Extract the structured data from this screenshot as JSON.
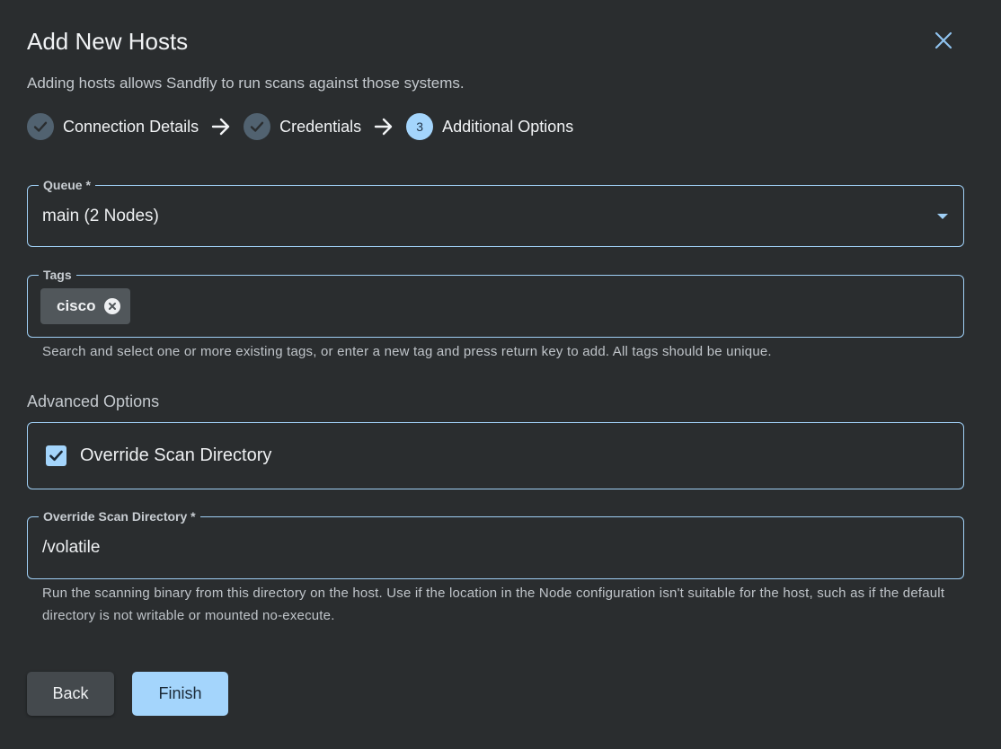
{
  "dialog": {
    "title": "Add New Hosts",
    "subtitle": "Adding hosts allows Sandfly to run scans against those systems.",
    "close_icon": "close-icon"
  },
  "stepper": {
    "steps": [
      {
        "label": "Connection Details",
        "status": "completed"
      },
      {
        "label": "Credentials",
        "status": "completed"
      },
      {
        "number": "3",
        "label": "Additional Options",
        "status": "active"
      }
    ]
  },
  "queue": {
    "label": "Queue *",
    "value": "main (2 Nodes)"
  },
  "tags": {
    "label": "Tags",
    "chips": [
      {
        "label": "cisco"
      }
    ],
    "hint": "Search and select one or more existing tags, or enter a new tag and press return key to add. All tags should be unique."
  },
  "advanced": {
    "title": "Advanced Options",
    "override_checkbox": {
      "label": "Override Scan Directory",
      "checked": true
    }
  },
  "scan_directory": {
    "label": "Override Scan Directory *",
    "value": "/volatile",
    "hint": "Run the scanning binary from this directory on the host. Use if the location in the Node configuration isn't suitable for the host, such as if the default directory is not writable or mounted no-execute."
  },
  "buttons": {
    "back": "Back",
    "finish": "Finish"
  },
  "colors": {
    "background": "#2a2d2f",
    "accent": "#a4d5fc",
    "border": "#9fcff5"
  }
}
